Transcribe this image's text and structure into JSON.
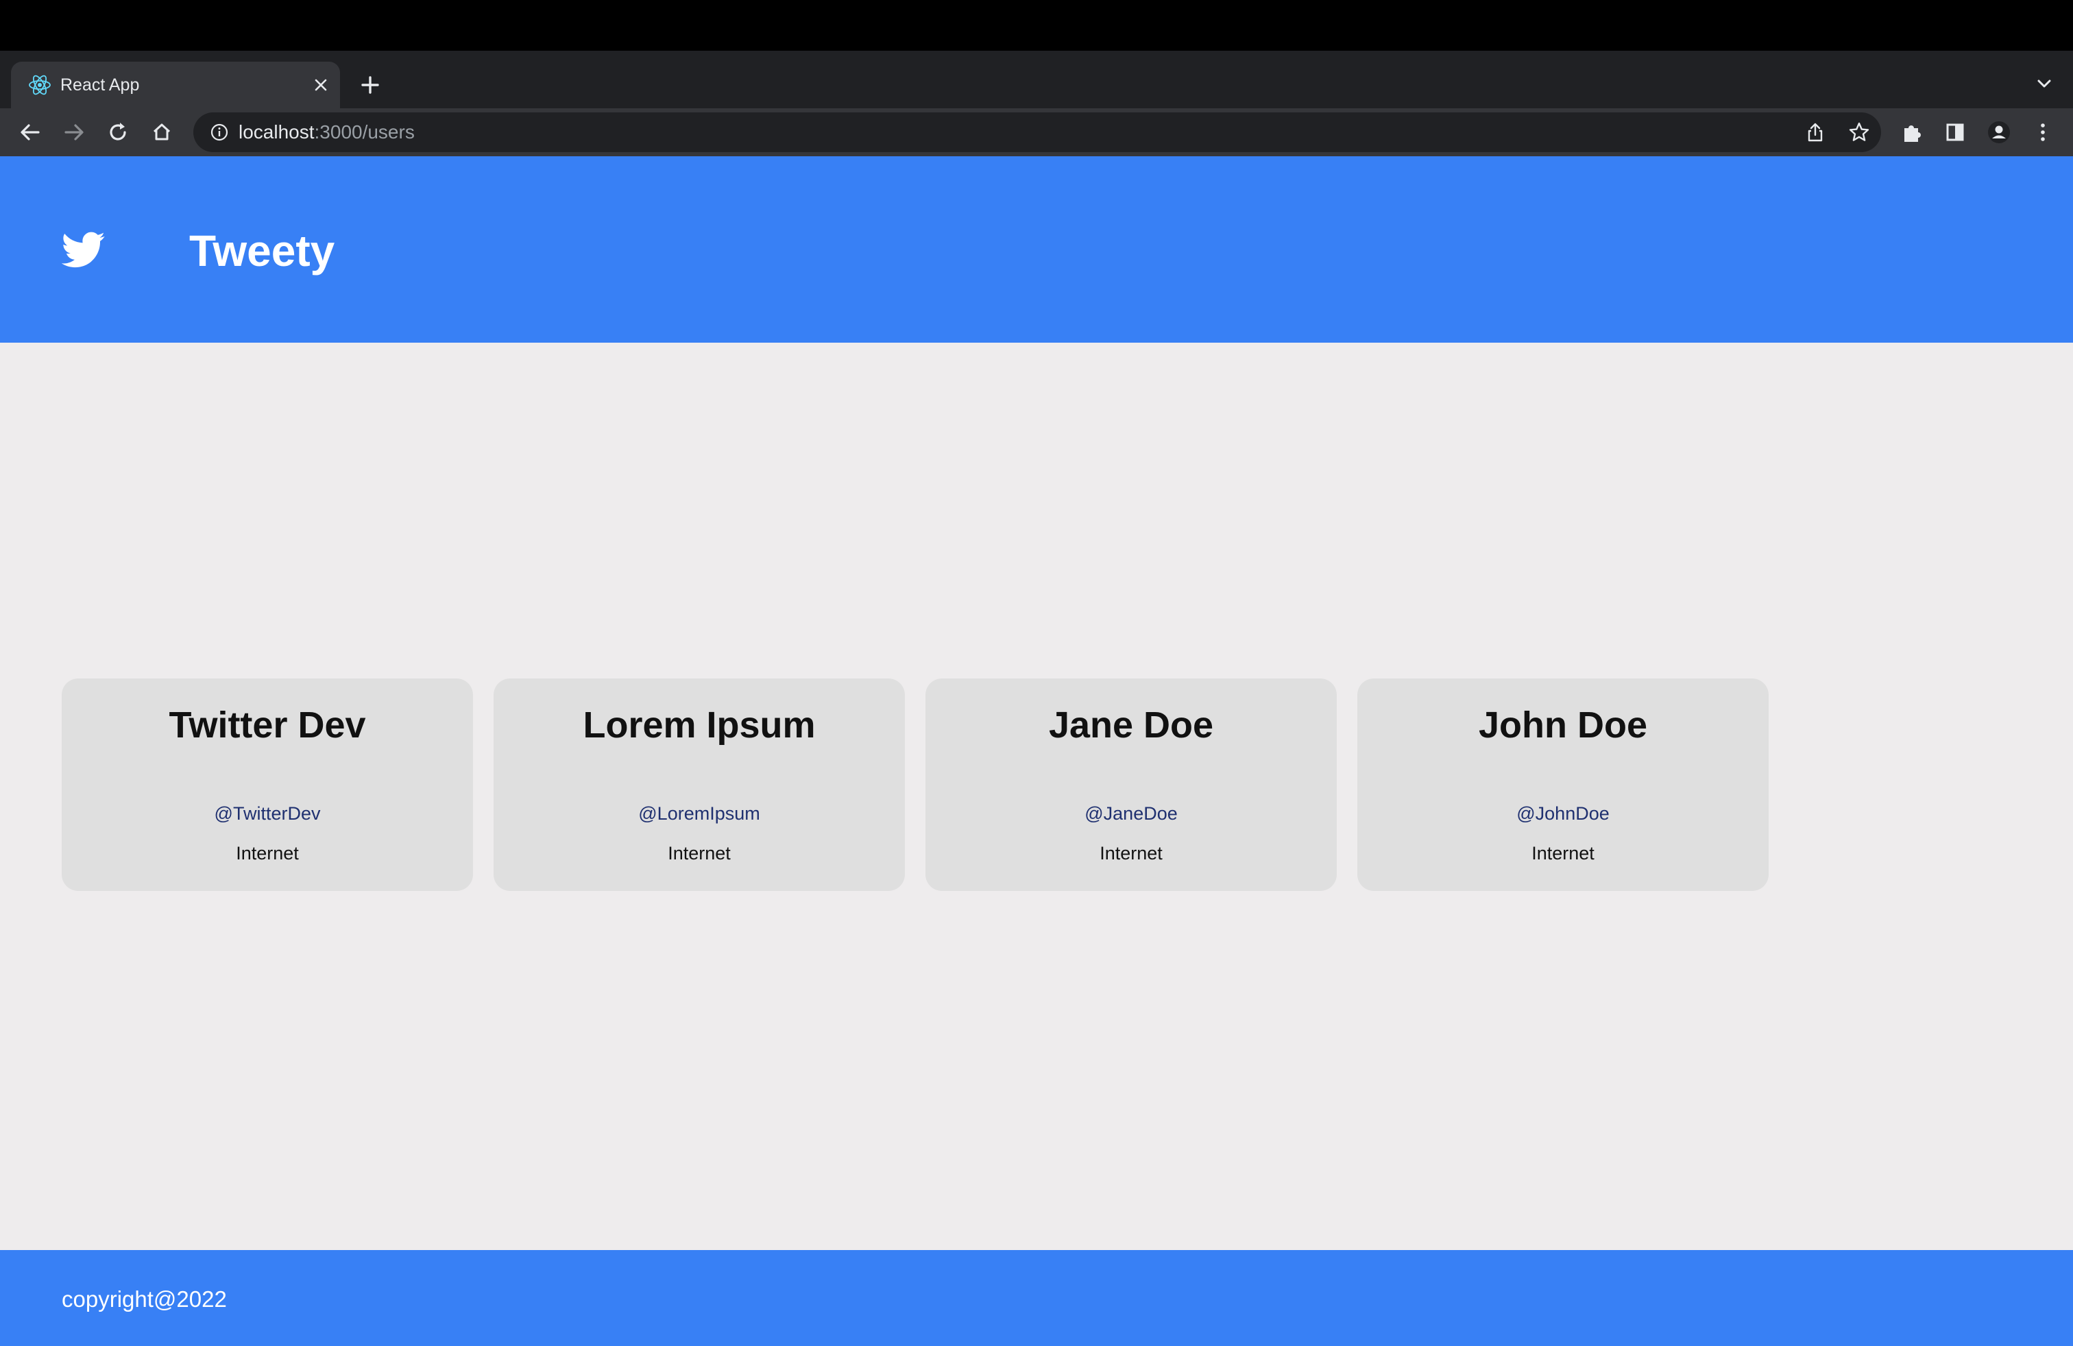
{
  "browser": {
    "tab_title": "React App",
    "url_host": "localhost",
    "url_rest": ":3000/users",
    "icons": [
      "react-favicon",
      "close-icon",
      "plus-icon",
      "chevron-down-icon",
      "back-arrow-icon",
      "forward-arrow-icon",
      "reload-icon",
      "home-icon",
      "info-icon",
      "share-icon",
      "star-icon",
      "puzzle-icon",
      "side-panel-icon",
      "profile-icon",
      "kebab-menu-icon"
    ]
  },
  "header": {
    "brand": "Tweety",
    "logo_icon": "twitter-bird-icon",
    "background": "#3880f5"
  },
  "users": [
    {
      "name": "Twitter Dev",
      "handle": "@TwitterDev",
      "location": "Internet"
    },
    {
      "name": "Lorem Ipsum",
      "handle": "@LoremIpsum",
      "location": "Internet"
    },
    {
      "name": "Jane Doe",
      "handle": "@JaneDoe",
      "location": "Internet"
    },
    {
      "name": "John Doe",
      "handle": "@JohnDoe",
      "location": "Internet"
    }
  ],
  "footer": {
    "copyright": "copyright@2022"
  },
  "colors": {
    "accent": "#3880f5",
    "page_bg": "#eeeced",
    "card_bg": "#dfdfdf",
    "handle": "#1f3070"
  }
}
